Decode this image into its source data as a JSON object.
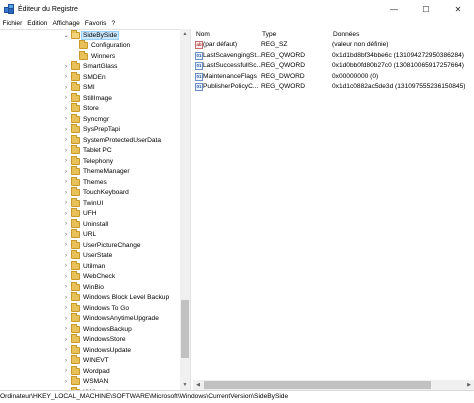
{
  "window": {
    "title": "Éditeur du Registre",
    "minimize_glyph": "—",
    "maximize_glyph": "☐",
    "close_glyph": "✕"
  },
  "menu": [
    "Fichier",
    "Edition",
    "Affichage",
    "Favoris",
    "?"
  ],
  "tree": {
    "selected": "SideBySide",
    "children_of_selected": [
      "Configuration",
      "Winners"
    ],
    "siblings": [
      "SmartGlass",
      "SMDEn",
      "SMI",
      "StillImage",
      "Store",
      "Syncmgr",
      "SysPrepTapi",
      "SystemProtectedUserData",
      "Tablet PC",
      "Telephony",
      "ThemeManager",
      "Themes",
      "TouchKeyboard",
      "TwinUI",
      "UFH",
      "Uninstall",
      "URL",
      "UserPictureChange",
      "UserState",
      "Utilman",
      "WebCheck",
      "WinBio",
      "Windows Block Level Backup",
      "Windows To Go",
      "WindowsAnytimeUpgrade",
      "WindowsBackup",
      "WindowsStore",
      "WindowsUpdate",
      "WINEVT",
      "Wordpad",
      "WSMAN",
      "XWizards"
    ]
  },
  "list": {
    "headers": {
      "name": "Nom",
      "type": "Type",
      "data": "Données"
    },
    "rows": [
      {
        "name": "(par défaut)",
        "type": "REG_SZ",
        "data": "(valeur non définie)",
        "icon": "string-value-icon"
      },
      {
        "name": "LastScavengingSt...",
        "type": "REG_QWORD",
        "data": "0x1d1bd8bf34bbe6c (131094272950386284)",
        "icon": "binary-value-icon"
      },
      {
        "name": "LastSuccessfullSc...",
        "type": "REG_QWORD",
        "data": "0x1d0bb0fd80b27c0 (130810065917257664)",
        "icon": "binary-value-icon"
      },
      {
        "name": "MaintenanceFlags",
        "type": "REG_DWORD",
        "data": "0x00000000 (0)",
        "icon": "binary-value-icon"
      },
      {
        "name": "PublisherPolicyC...",
        "type": "REG_QWORD",
        "data": "0x1d1c0882ac5de3d (131097555236150845)",
        "icon": "binary-value-icon"
      }
    ]
  },
  "icon_glyphs": {
    "sz": "ab",
    "bin": "01"
  },
  "status": {
    "path": "Ordinateur\\HKEY_LOCAL_MACHINE\\SOFTWARE\\Microsoft\\Windows\\CurrentVersion\\SideBySide"
  }
}
